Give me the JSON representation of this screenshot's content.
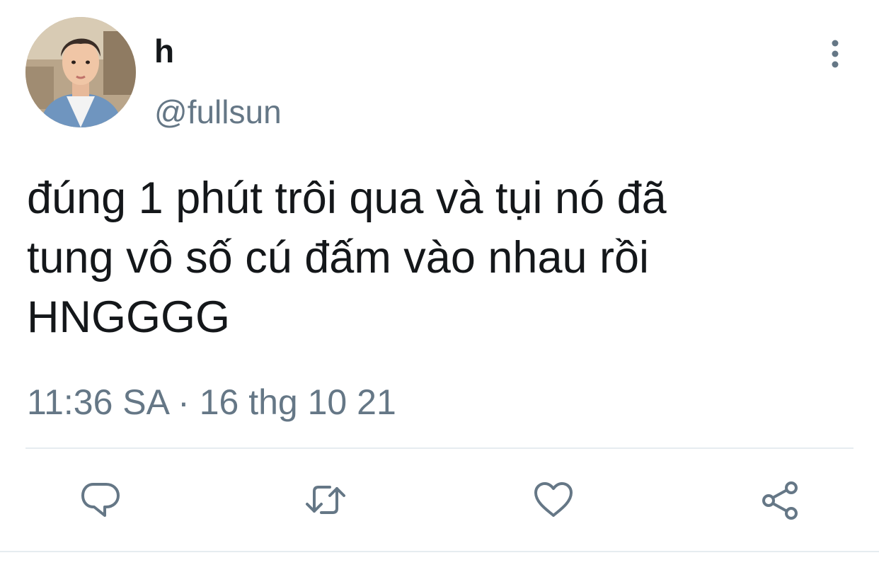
{
  "user": {
    "display_name": "h",
    "handle": "@fullsun",
    "avatar_icon": "profile-photo"
  },
  "tweet": {
    "text": "đúng 1 phút trôi qua và tụi nó đã\ntung vô số cú đấm vào nhau rồi\nHNGGGG",
    "time": "11:36 SA",
    "separator": "·",
    "date": "16 thg 10 21"
  },
  "actions": {
    "reply_icon": "reply-icon",
    "retweet_icon": "retweet-icon",
    "like_icon": "like-heart-icon",
    "share_icon": "share-icon",
    "more_icon": "more-vertical-icon"
  },
  "colors": {
    "text": "#14171a",
    "secondary": "#657786",
    "divider": "#e6ecf0"
  }
}
